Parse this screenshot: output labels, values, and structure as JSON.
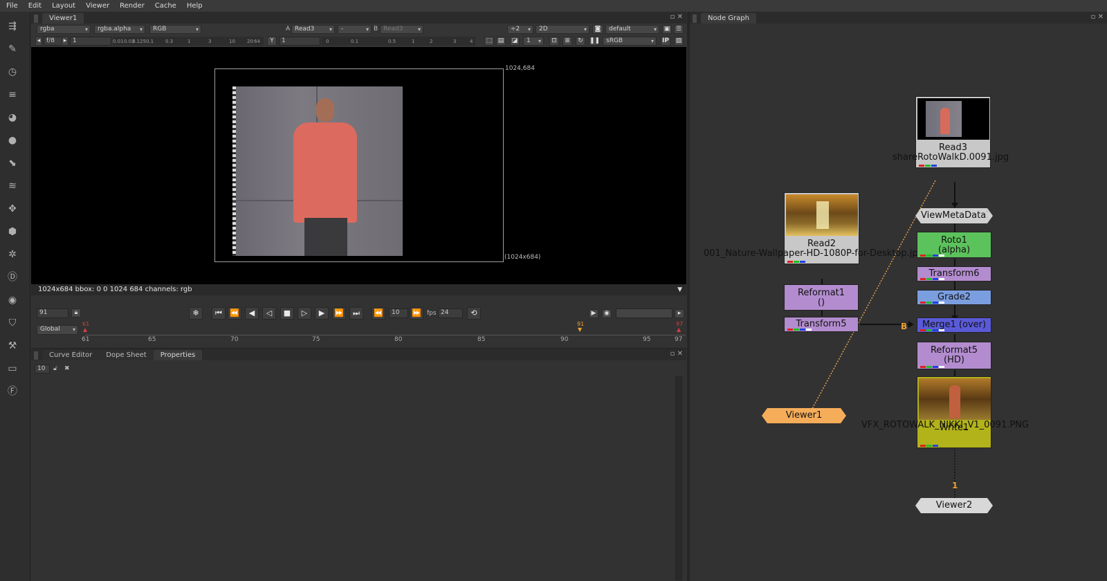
{
  "menu": [
    "File",
    "Edit",
    "Layout",
    "Viewer",
    "Render",
    "Cache",
    "Help"
  ],
  "viewer": {
    "tab": "Viewer1",
    "channels": "rgba",
    "alpha_channel": "rgba.alpha",
    "display_channels": "RGB",
    "a_label": "A",
    "a_input": "Read3",
    "dash": "-",
    "b_label": "B",
    "b_input": "Read3",
    "downscale": "÷2",
    "mode": "2D",
    "lut": "default",
    "fstop": "f/8",
    "gain_value": "1",
    "gain_ticks": [
      "0.01",
      "0.03",
      "0.125",
      "0.1",
      "0.3",
      "1",
      "3",
      "10",
      "20",
      "64"
    ],
    "y_label": "Y",
    "gamma_value": "1",
    "gamma_ticks": [
      "0",
      "0.1",
      "0.5",
      "1",
      "2",
      "3",
      "4"
    ],
    "frame_step": "1",
    "colorspace": "sRGB",
    "ip_label": "IP",
    "format_top": "1024,684",
    "format_bottom": "(1024x684)",
    "info": "1024x684 bbox: 0 0 1024 684 channels: rgb"
  },
  "transport": {
    "frame": "91",
    "increment": "10",
    "fps_label": "fps",
    "fps": "24",
    "global": "Global"
  },
  "timeline": {
    "ticks": [
      "61",
      "65",
      "70",
      "75",
      "80",
      "85",
      "90",
      "95",
      "97"
    ],
    "in_marker": "61",
    "current_marker": "91",
    "out_marker": "97"
  },
  "lower_panel": {
    "tabs": [
      "Curve Editor",
      "Dope Sheet",
      "Properties"
    ],
    "max_panels": "10"
  },
  "nodegraph": {
    "tab": "Node Graph",
    "nodes": {
      "read3": {
        "name": "Read3",
        "file": "shareRotoWalkD.0091.jpg"
      },
      "read2": {
        "name": "Read2",
        "file": "001_Nature-Wallpaper-HD-1080P-for-Desktop.jpg"
      },
      "viewmeta": {
        "name": "ViewMetaData1"
      },
      "roto1": {
        "name": "Roto1",
        "sub": "(alpha)"
      },
      "transform6": {
        "name": "Transform6"
      },
      "reformat1": {
        "name": "Reformat1",
        "sub": "()"
      },
      "grade2": {
        "name": "Grade2"
      },
      "transform5": {
        "name": "Transform5"
      },
      "merge1": {
        "name": "Merge1 (over)"
      },
      "reformat5": {
        "name": "Reformat5",
        "sub": "(HD)"
      },
      "write1": {
        "name": "Write1",
        "file": "VFX_ROTOWALK_NIKKI_V1_0091.PNG"
      },
      "viewer1": {
        "name": "Viewer1"
      },
      "viewer2": {
        "name": "Viewer2"
      }
    },
    "b_input_label": "B",
    "viewer_input_label": "1"
  },
  "colors": {
    "roto": "#5cc25c",
    "transform": "#b38ccf",
    "grade": "#7b9ee0",
    "merge": "#5a5ad8",
    "reformat": "#b38ccf",
    "write": "#b2b21a",
    "viewer_active": "#f6ad5a",
    "viewer_idle": "#d8d8d8",
    "read": "#c8c8c8"
  }
}
